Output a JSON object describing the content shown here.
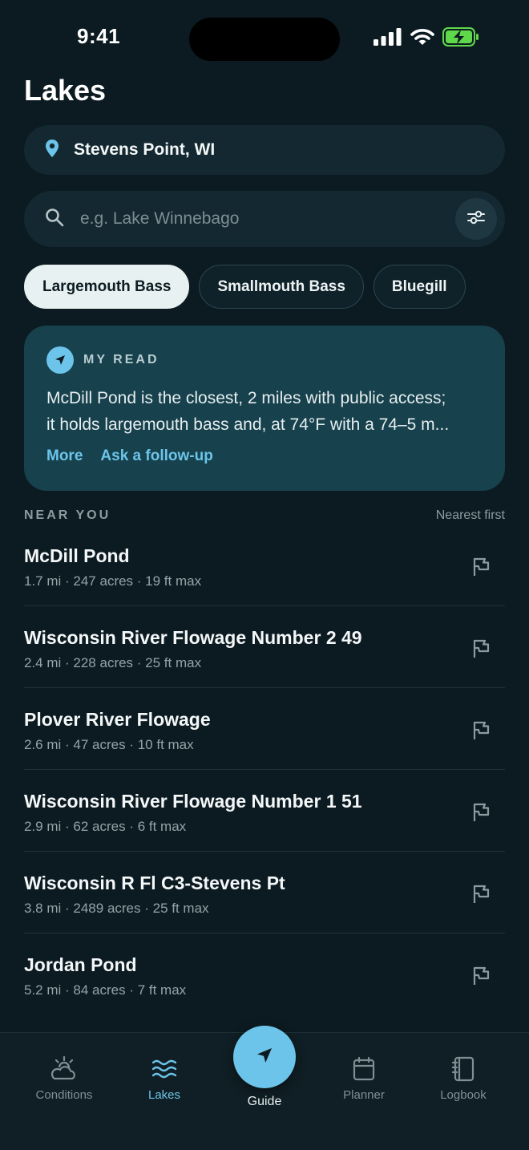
{
  "status_bar": {
    "time": "9:41"
  },
  "header": {
    "title": "Lakes"
  },
  "location": {
    "label": "Stevens Point, WI"
  },
  "search": {
    "placeholder": "e.g. Lake Winnebago",
    "value": ""
  },
  "species_chips": [
    {
      "label": "Largemouth Bass",
      "active": true
    },
    {
      "label": "Smallmouth Bass",
      "active": false
    },
    {
      "label": "Bluegill",
      "active": false
    }
  ],
  "my_read": {
    "label": "MY READ",
    "text_line1": "McDill Pond is the closest, 2 miles with public access;",
    "text_line2": "it holds largemouth bass and, at 74°F with a 74–5 m...",
    "more_label": "More",
    "followup_label": "Ask a follow-up"
  },
  "near_you": {
    "title": "NEAR YOU",
    "sort_label": "Nearest first",
    "lakes": [
      {
        "name": "McDill Pond",
        "meta": "1.7 mi · 247 acres · 19 ft max"
      },
      {
        "name": "Wisconsin River Flowage Number 2 49",
        "meta": "2.4 mi · 228 acres · 25 ft max"
      },
      {
        "name": "Plover River Flowage",
        "meta": "2.6 mi · 47 acres · 10 ft max"
      },
      {
        "name": "Wisconsin River Flowage Number 1 51",
        "meta": "2.9 mi · 62 acres · 6 ft max"
      },
      {
        "name": "Wisconsin R Fl C3-Stevens Pt",
        "meta": "3.8 mi · 2489 acres · 25 ft max"
      },
      {
        "name": "Jordan Pond",
        "meta": "5.2 mi · 84 acres · 7 ft max"
      }
    ]
  },
  "tab_bar": {
    "conditions": "Conditions",
    "lakes": "Lakes",
    "guide": "Guide",
    "planner": "Planner",
    "logbook": "Logbook"
  },
  "colors": {
    "background": "#0c1b21",
    "accent": "#6cc4ea",
    "card": "#17414c",
    "battery": "#5fd94a"
  }
}
